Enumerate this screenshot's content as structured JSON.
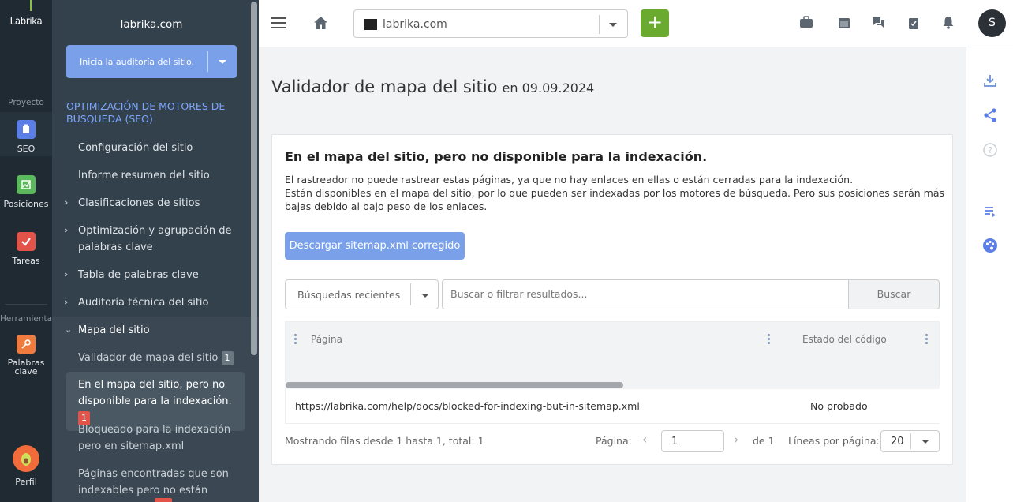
{
  "rail": {
    "logo": "Labrika",
    "project_label": "Proyecto",
    "tools_label": "Herramientas",
    "items": [
      {
        "label": "SEO"
      },
      {
        "label": "Posiciones"
      },
      {
        "label": "Tareas"
      },
      {
        "label": "Palabras clave"
      },
      {
        "label": "Perfil"
      }
    ],
    "colors": {
      "seo": "#5b7fe6",
      "positions": "#5cb85c",
      "tasks": "#e2534a",
      "keywords": "#f07b3f"
    }
  },
  "sidebar": {
    "site": "labrika.com",
    "audit_button": "Inicia la auditoría del sitio.",
    "group_title": "OPTIMIZACIÓN DE MOTORES DE BÚSQUEDA (SEO)",
    "items": [
      {
        "label": "Configuración del sitio"
      },
      {
        "label": "Informe resumen del sitio"
      },
      {
        "label": "Clasificaciones de sitios"
      },
      {
        "label": "Optimización y agrupación de palabras clave"
      },
      {
        "label": "Tabla de palabras clave"
      },
      {
        "label": "Auditoría técnica del sitio"
      },
      {
        "label": "Mapa del sitio"
      }
    ],
    "subitems": [
      {
        "label": "Validador de mapa del sitio",
        "badge": "1"
      },
      {
        "label": "En el mapa del sitio, pero no disponible para la indexación.",
        "badge": "1"
      },
      {
        "label": "Bloqueado para la indexación pero en sitemap.xml"
      },
      {
        "label": "Páginas encontradas que son indexables pero no están listadas"
      }
    ]
  },
  "topbar": {
    "site_select": "labrika.com",
    "add_label": "+",
    "user_initial": "S",
    "icons": [
      "briefcase-icon",
      "calendar-icon",
      "chat-icon",
      "clipboard-icon",
      "bell-icon"
    ]
  },
  "main": {
    "title": "Validador de mapa del sitio",
    "date": "en 09.09.2024",
    "card": {
      "heading": "En el mapa del sitio, pero no disponible para la indexación.",
      "desc1": "El rastreador no puede rastrear estas páginas, ya que no hay enlaces en ellas o están cerradas para la indexación.",
      "desc2": "Están disponibles en el mapa del sitio, por lo que pueden ser indexadas por los motores de búsqueda. Pero sus posiciones serán más bajas debido al bajo peso de los enlaces.",
      "download_button": "Descargar sitemap.xml corregido",
      "recent_searches": "Búsquedas recientes",
      "search_placeholder": "Buscar o filtrar resultados...",
      "search_button": "Buscar",
      "columns": [
        "Página",
        "Estado del código"
      ],
      "rows": [
        {
          "page": "https://labrika.com/help/docs/blocked-for-indexing-but-in-sitemap.xml",
          "status": "No probado"
        }
      ],
      "footer": {
        "showing": "Mostrando filas desde 1 hasta 1, total: 1",
        "page_label": "Página:",
        "page_value": "1",
        "of": "de 1",
        "lines_label": "Líneas por página:",
        "lines_value": "20"
      }
    }
  }
}
